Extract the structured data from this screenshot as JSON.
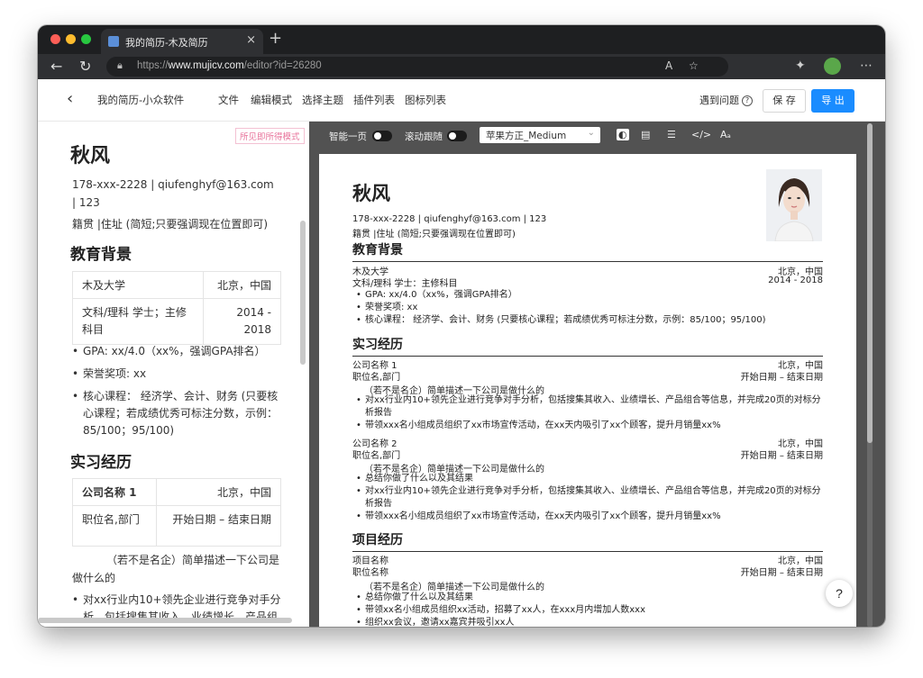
{
  "browser": {
    "tab_title": "我的简历-木及简历",
    "new_tab": "+",
    "tab_close": "×",
    "url_prefix": "https://",
    "url_host": "www.mujicv.com",
    "url_path": "/editor?id=26280"
  },
  "app": {
    "title": "我的简历-小众软件",
    "menu": [
      "文件",
      "编辑模式",
      "选择主题",
      "插件列表",
      "图标列表"
    ],
    "help_label": "遇到问题",
    "save_label": "保 存",
    "export_label": "导 出"
  },
  "editor": {
    "mode_badge": "所见即所得模式",
    "name": "秋风",
    "contact": "178-xxx-2228 | qiufenghyf@163.com | 123",
    "address": "籍贯 |住址 (简短;只要强调现在位置即可)",
    "education_heading": "教育背景",
    "edu_table": [
      [
        "木及大学",
        "北京，中国"
      ],
      [
        "文科/理科 学士；主修科目",
        "2014 - 2018"
      ]
    ],
    "edu_items": [
      "GPA: xx/4.0（xx%，强调GPA排名）",
      "荣誉奖项: xx",
      "核心课程： 经济学、会计、财务 (只要核心课程；若成绩优秀可标注分数，示例：85/100；95/100)"
    ],
    "intern_heading": "实习经历",
    "intern_table": [
      [
        "公司名称 1",
        "北京，中国"
      ],
      [
        "职位名,部门",
        "开始日期 – 结束日期"
      ]
    ],
    "intern_desc": "（若不是名企）简单描述一下公司是做什么的",
    "intern_item": "对xx行业内10+领先企业进行竞争对手分析，包括搜集其收入、业绩增长、产品组"
  },
  "toolbar": {
    "smart_page": "智能一页",
    "scroll_follow": "滚动跟随",
    "font": "苹果方正_Medium"
  },
  "preview": {
    "name": "秋风",
    "contact": "178-xxx-2228 | qiufenghyf@163.com | 123",
    "address": "籍贯 |住址 (简短;只要强调现在位置即可)",
    "edu_heading": "教育背景",
    "edu_school": "木及大学",
    "edu_loc": "北京，中国",
    "edu_degree": "文科/理科 学士：主修科目",
    "edu_years": "2014 - 2018",
    "edu_items": [
      "GPA: xx/4.0（xx%，强调GPA排名）",
      "荣誉奖项: xx",
      "核心课程： 经济学、会计、财务 (只要核心课程；若成绩优秀可标注分数，示例：85/100；95/100)"
    ],
    "intern_heading": "实习经历",
    "c1_name": "公司名称 1",
    "c1_loc": "北京，中国",
    "c1_pos": "职位名,部门",
    "c1_date": "开始日期 – 结束日期",
    "c1_desc": "（若不是名企）简单描述一下公司是做什么的",
    "c1_items": [
      "对xx行业内10+领先企业进行竞争对手分析，包括搜集其收入、业绩增长、产品组合等信息，并完成20页的对标分析报告",
      "带领xxx名小组成员组织了xx市场宣传活动，在xx天内吸引了xx个顾客，提升月销量xx%"
    ],
    "c2_name": "公司名称 2",
    "c2_loc": "北京，中国",
    "c2_pos": "职位名,部门",
    "c2_date": "开始日期 – 结束日期",
    "c2_desc": "（若不是名企）简单描述一下公司是做什么的",
    "c2_items": [
      "总结你做了什么以及其结果",
      "对xx行业内10+领先企业进行竞争对手分析，包括搜集其收入、业绩增长、产品组合等信息，并完成20页的对标分析报告",
      "带领xxx名小组成员组织了xx市场宣传活动，在xx天内吸引了xx个顾客，提升月销量xx%"
    ],
    "proj_heading": "项目经历",
    "p_name": "项目名称",
    "p_loc": "北京，中国",
    "p_pos": "职位名称",
    "p_date": "开始日期 – 结束日期",
    "p_desc": "（若不是名企）简单描述一下公司是做什么的",
    "p_items": [
      "总结你做了什么以及其结果",
      "带领xx名小组成员组织xx活动，招募了xx人，在xxx月内增加人数xxx",
      "组织xx会议，邀请xx嘉宾并吸引xx人"
    ]
  },
  "help_button": "?"
}
